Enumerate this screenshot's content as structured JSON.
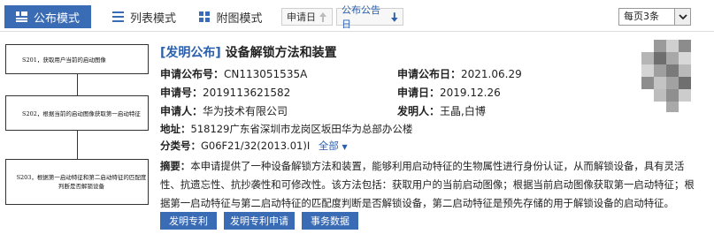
{
  "toolbar": {
    "tabs": [
      {
        "label": "公布模式",
        "icon": "grid-icon",
        "active": true
      },
      {
        "label": "列表模式",
        "icon": "list-icon",
        "active": false
      },
      {
        "label": "附图模式",
        "icon": "tiles-icon",
        "active": false
      }
    ],
    "sort": [
      {
        "label": "申请日",
        "direction": "up",
        "active": false
      },
      {
        "label": "公布公告日",
        "direction": "down",
        "active": true
      }
    ],
    "per_page": "每页3条",
    "accent_color": "#3a6bb5",
    "link_color": "#2a5fae"
  },
  "drawing": {
    "steps": [
      "S201，获取用户当前的启动图像",
      "S202，根据当前的启动图像获取第一启动特征",
      "S203，根据第一启动特征和第二启动特征的匹配度判断是否解锁设备"
    ]
  },
  "record": {
    "tag": "[发明公布]",
    "title": "设备解锁方法和装置",
    "pub_no_label": "申请公布号：",
    "pub_no": "CN113051535A",
    "pub_date_label": "申请公布日：",
    "pub_date": "2021.06.29",
    "app_no_label": "申请号：",
    "app_no": "2019113621582",
    "app_date_label": "申请日：",
    "app_date": "2019.12.26",
    "applicant_label": "申请人：",
    "applicant": "华为技术有限公司",
    "inventor_label": "发明人：",
    "inventor": "王晶,白博",
    "address_label": "地址：",
    "address": "518129广东省深圳市龙岗区坂田华为总部办公楼",
    "class_label": "分类号：",
    "class_no": "G06F21/32(2013.01)I",
    "class_all": "全部",
    "abstract_label": "摘要：",
    "abstract": "本申请提供了一种设备解锁方法和装置，能够利用启动特征的生物属性进行身份认证，从而解锁设备，具有灵活性、抗遗忘性、抗抄袭性和可修改性。该方法包括：获取用户的当前启动图像；根据当前启动图像获取第一启动特征；根据第一启动特征与第二启动特征的匹配度判断是否解锁设备，第二启动特征是预先存储的用于解锁设备的启动特征。"
  },
  "actions": [
    {
      "label": "发明专利"
    },
    {
      "label": "发明专利申请"
    },
    {
      "label": "事务数据"
    }
  ]
}
